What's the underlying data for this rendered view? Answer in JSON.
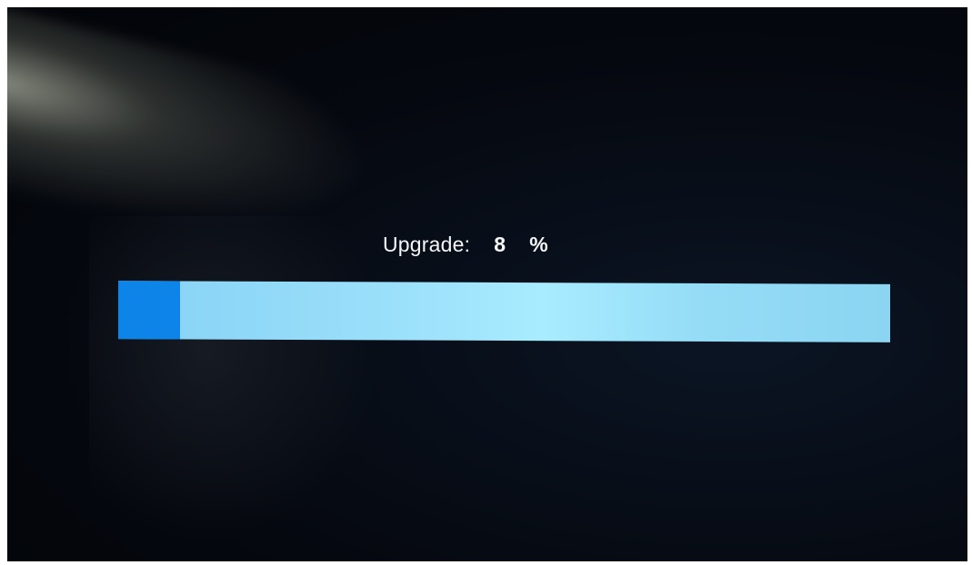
{
  "upgrade": {
    "label": "Upgrade:",
    "value": "8",
    "unit": "%",
    "progress_fraction": 0.08
  },
  "colors": {
    "progress_fill": "#0c84e8",
    "progress_track": "#9ee2fb",
    "text": "#f4f6f8",
    "background": "#05080f"
  }
}
